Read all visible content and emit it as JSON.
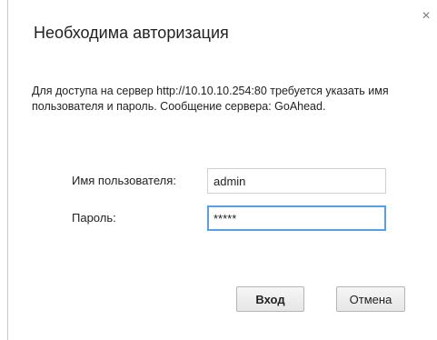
{
  "dialog": {
    "title": "Необходима авторизация",
    "close_glyph": "×",
    "message": "Для доступа на сервер http://10.10.10.254:80 требуется указать имя пользователя и пароль. Сообщение сервера: GoAhead."
  },
  "form": {
    "username_label": "Имя пользователя:",
    "username_value": "admin",
    "password_label": "Пароль:",
    "password_value": "*****"
  },
  "buttons": {
    "login": "Вход",
    "cancel": "Отмена"
  },
  "colors": {
    "focus_border": "#5a9ee6",
    "text": "#222222"
  }
}
